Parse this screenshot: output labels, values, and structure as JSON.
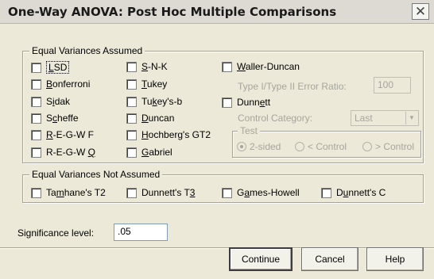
{
  "window": {
    "title": "One-Way ANOVA: Post Hoc Multiple Comparisons",
    "close_glyph": "✕"
  },
  "equal_variances_assumed": {
    "label": "Equal Variances Assumed",
    "col1": [
      {
        "pre": "",
        "key": "L",
        "post": "SD",
        "checked": false
      },
      {
        "pre": "",
        "key": "B",
        "post": "onferroni",
        "checked": false
      },
      {
        "pre": "S",
        "key": "i",
        "post": "dak",
        "checked": false
      },
      {
        "pre": "S",
        "key": "c",
        "post": "heffe",
        "checked": false
      },
      {
        "pre": "",
        "key": "R",
        "post": "-E-G-W F",
        "checked": false
      },
      {
        "pre": "R-E-G-W ",
        "key": "Q",
        "post": "",
        "checked": false
      }
    ],
    "col2": [
      {
        "pre": "",
        "key": "S",
        "post": "-N-K",
        "checked": false
      },
      {
        "pre": "",
        "key": "T",
        "post": "ukey",
        "checked": false
      },
      {
        "pre": "Tu",
        "key": "k",
        "post": "ey's-b",
        "checked": false
      },
      {
        "pre": "",
        "key": "D",
        "post": "uncan",
        "checked": false
      },
      {
        "pre": "",
        "key": "H",
        "post": "ochberg's GT2",
        "checked": false
      },
      {
        "pre": "",
        "key": "G",
        "post": "abriel",
        "checked": false
      }
    ],
    "waller": {
      "pre": "",
      "key": "W",
      "post": "aller-Duncan",
      "checked": false
    },
    "type_ratio_label": "Type I/Type II Error Ratio:",
    "type_ratio_value": "100",
    "dunnett": {
      "pre": "Dunn",
      "key": "e",
      "post": "tt",
      "checked": false
    },
    "control_category_label": "Control Category:",
    "control_category_value": "Last",
    "test_label": "Test",
    "radios": [
      {
        "label": "2-sided",
        "selected": true
      },
      {
        "label": "< Control",
        "selected": false
      },
      {
        "label": "> Control",
        "selected": false
      }
    ]
  },
  "equal_variances_not_assumed": {
    "label": "Equal Variances Not Assumed",
    "items": [
      {
        "pre": "Ta",
        "key": "m",
        "post": "hane's T2",
        "checked": false
      },
      {
        "pre": "Dunnett's T",
        "key": "3",
        "post": "",
        "checked": false
      },
      {
        "pre": "G",
        "key": "a",
        "post": "mes-Howell",
        "checked": false
      },
      {
        "pre": "D",
        "key": "u",
        "post": "nnett's C",
        "checked": false
      }
    ]
  },
  "significance": {
    "label": "Significance level:",
    "value": ".05"
  },
  "buttons": {
    "continue": "Continue",
    "cancel": "Cancel",
    "help": "Help"
  }
}
